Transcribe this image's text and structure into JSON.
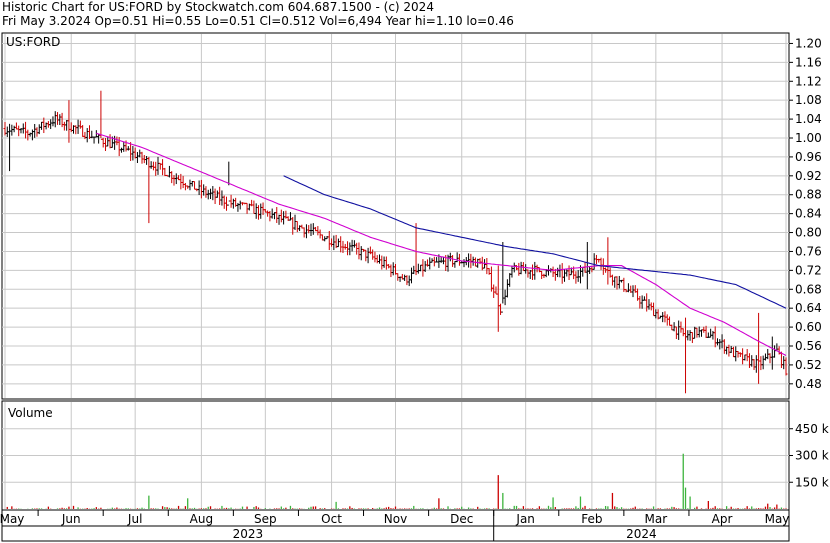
{
  "header": {
    "line1": "Historic Chart for US:FORD by Stockwatch.com 604.687.1500 - (c) 2024",
    "line2": "Fri May  3.2024  Op=0.51  Hi=0.55  Lo=0.51  Cl=0.512  Vol=6,494  Year hi=1.10  lo=0.46"
  },
  "colors": {
    "up": "#000000",
    "down": "#cc0000",
    "ma_short": "#d000d0",
    "ma_long": "#1010a0",
    "vol_up": "#3cb43c",
    "vol_down": "#cc0000",
    "grid": "#c8c8c8"
  },
  "chart_data": [
    {
      "type": "ohlc",
      "title": "US:FORD",
      "x_months": [
        "May",
        "Jun",
        "Jul",
        "Aug",
        "Sep",
        "Oct",
        "Nov",
        "Dec",
        "Jan",
        "Feb",
        "Mar",
        "Apr",
        "May"
      ],
      "x_years": [
        "2023",
        "2024"
      ],
      "y_ticks": [
        "1.20",
        "1.16",
        "1.12",
        "1.08",
        "1.04",
        "1.00",
        "0.96",
        "0.92",
        "0.88",
        "0.84",
        "0.80",
        "0.76",
        "0.72",
        "0.68",
        "0.64",
        "0.60",
        "0.56",
        "0.52",
        "0.48"
      ],
      "ylim": [
        0.45,
        1.22
      ],
      "grid": true,
      "price_path": [
        [
          0,
          1.02
        ],
        [
          10,
          1.01
        ],
        [
          22,
          1.04
        ],
        [
          40,
          1.0
        ],
        [
          55,
          0.97
        ],
        [
          70,
          0.93
        ],
        [
          85,
          0.89
        ],
        [
          100,
          0.86
        ],
        [
          115,
          0.84
        ],
        [
          130,
          0.81
        ],
        [
          145,
          0.78
        ],
        [
          160,
          0.75
        ],
        [
          170,
          0.72
        ],
        [
          175,
          0.7
        ],
        [
          185,
          0.73
        ],
        [
          195,
          0.74
        ],
        [
          205,
          0.74
        ],
        [
          210,
          0.73
        ],
        [
          217,
          0.64
        ],
        [
          222,
          0.72
        ],
        [
          232,
          0.72
        ],
        [
          245,
          0.71
        ],
        [
          255,
          0.72
        ],
        [
          260,
          0.75
        ],
        [
          263,
          0.72
        ],
        [
          270,
          0.69
        ],
        [
          280,
          0.65
        ],
        [
          290,
          0.61
        ],
        [
          298,
          0.58
        ],
        [
          303,
          0.59
        ],
        [
          310,
          0.58
        ],
        [
          320,
          0.54
        ],
        [
          330,
          0.52
        ],
        [
          338,
          0.55
        ],
        [
          342,
          0.51
        ]
      ],
      "spikes": [
        [
          2,
          0.93,
          1.03
        ],
        [
          42,
          1.0,
          1.1
        ],
        [
          28,
          0.99,
          1.08
        ],
        [
          63,
          0.82,
          0.96
        ],
        [
          98,
          0.9,
          0.95
        ],
        [
          180,
          0.71,
          0.82
        ],
        [
          216,
          0.59,
          0.73
        ],
        [
          218,
          0.65,
          0.78
        ],
        [
          255,
          0.68,
          0.78
        ],
        [
          264,
          0.69,
          0.79
        ],
        [
          298,
          0.46,
          0.62
        ],
        [
          330,
          0.48,
          0.63
        ],
        [
          336,
          0.51,
          0.58
        ]
      ],
      "ma_short": [
        [
          40,
          1.01
        ],
        [
          60,
          0.98
        ],
        [
          80,
          0.94
        ],
        [
          100,
          0.9
        ],
        [
          120,
          0.86
        ],
        [
          140,
          0.83
        ],
        [
          160,
          0.79
        ],
        [
          180,
          0.76
        ],
        [
          200,
          0.74
        ],
        [
          220,
          0.73
        ],
        [
          240,
          0.72
        ],
        [
          260,
          0.73
        ],
        [
          270,
          0.73
        ],
        [
          285,
          0.69
        ],
        [
          300,
          0.64
        ],
        [
          315,
          0.61
        ],
        [
          330,
          0.57
        ],
        [
          342,
          0.54
        ]
      ],
      "ma_long": [
        [
          122,
          0.92
        ],
        [
          140,
          0.88
        ],
        [
          160,
          0.85
        ],
        [
          180,
          0.81
        ],
        [
          200,
          0.79
        ],
        [
          220,
          0.77
        ],
        [
          240,
          0.755
        ],
        [
          260,
          0.73
        ],
        [
          280,
          0.72
        ],
        [
          300,
          0.71
        ],
        [
          320,
          0.69
        ],
        [
          342,
          0.64
        ]
      ]
    },
    {
      "type": "bar",
      "title": "Volume",
      "y_ticks": [
        "450 k",
        "300 k",
        "150 k"
      ],
      "ylim": [
        0,
        600000
      ],
      "spikes": [
        [
          63,
          75000
        ],
        [
          80,
          60000
        ],
        [
          145,
          40000
        ],
        [
          190,
          60000
        ],
        [
          216,
          190000
        ],
        [
          218,
          90000
        ],
        [
          240,
          65000
        ],
        [
          252,
          70000
        ],
        [
          266,
          90000
        ],
        [
          297,
          310000
        ],
        [
          298,
          120000
        ],
        [
          300,
          70000
        ],
        [
          308,
          45000
        ],
        [
          334,
          30000
        ],
        [
          338,
          25000
        ]
      ]
    }
  ]
}
